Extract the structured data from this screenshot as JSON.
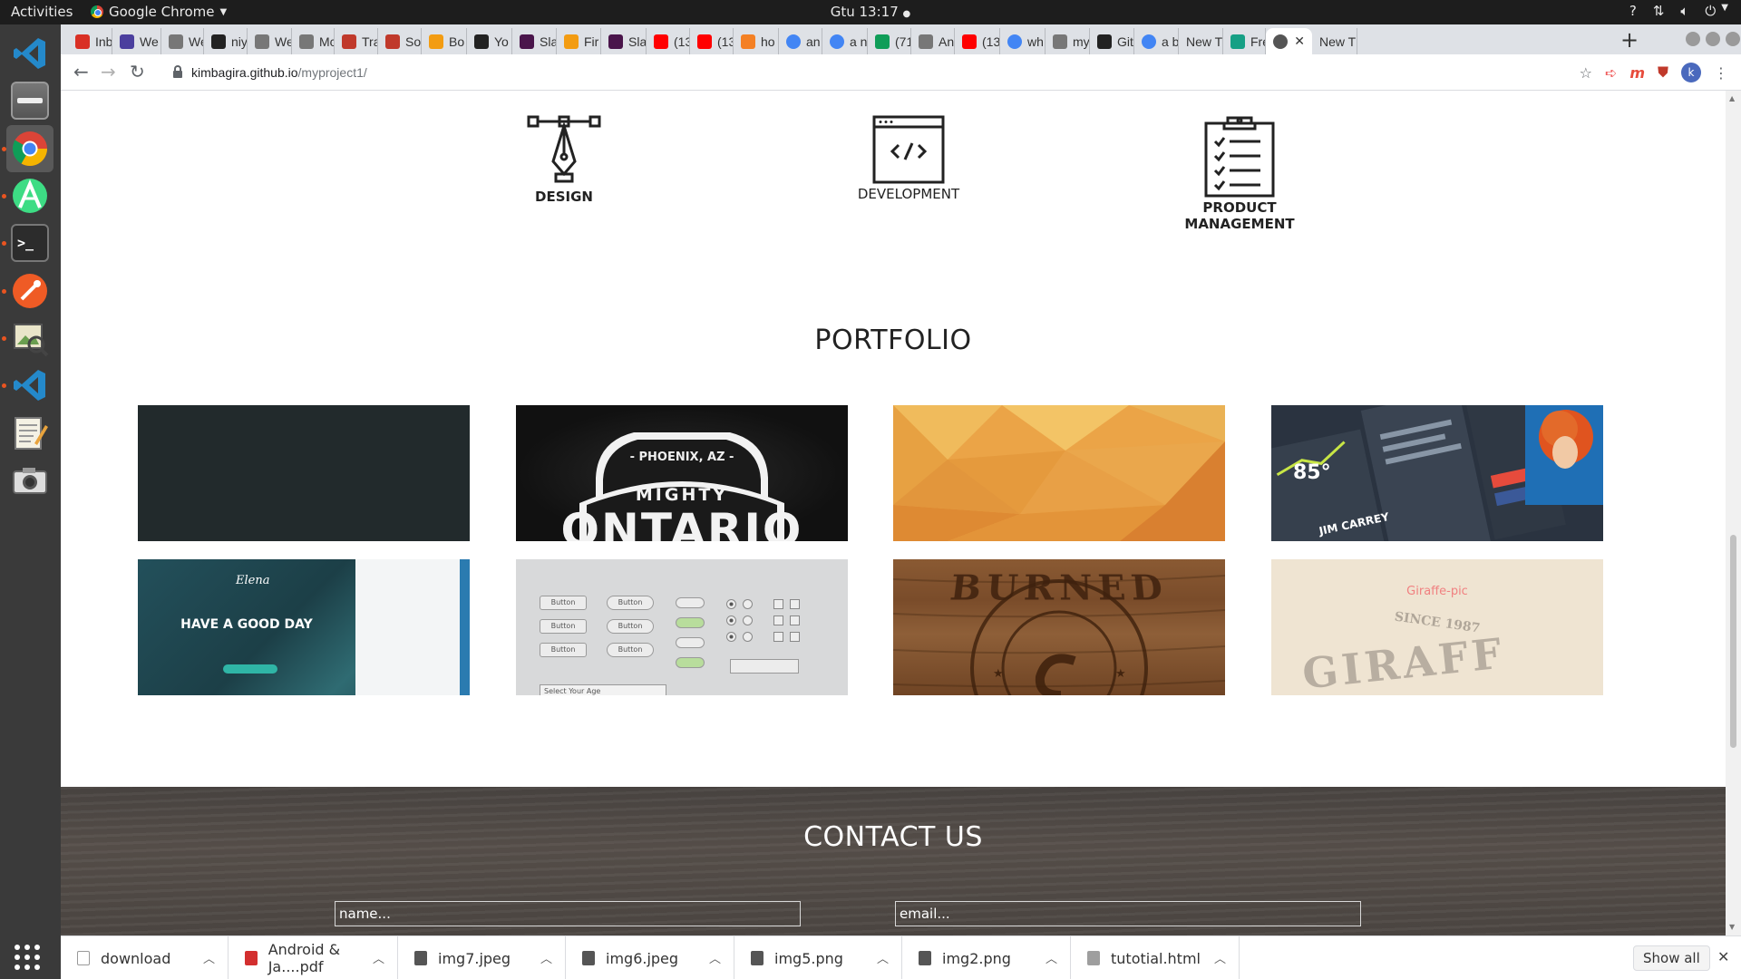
{
  "topbar": {
    "activities": "Activities",
    "app_name": "Google Chrome",
    "clock": "Gtu 13:17",
    "tray_icons": [
      "help-icon",
      "network-icon",
      "volume-icon",
      "power-icon"
    ]
  },
  "dock": {
    "items": [
      "vscode",
      "files",
      "chrome",
      "android-studio",
      "terminal",
      "postman",
      "image-viewer",
      "vscode",
      "text-editor",
      "screenshot"
    ]
  },
  "tabs": [
    {
      "label": "Inb",
      "icon": "gmail-icon",
      "color": "#d93025"
    },
    {
      "label": "We",
      "icon": "web-icon",
      "color": "#4b3f9e"
    },
    {
      "label": "We",
      "icon": "web-icon",
      "color": "#777"
    },
    {
      "label": "niy",
      "icon": "github-icon",
      "color": "#222"
    },
    {
      "label": "We",
      "icon": "web-icon",
      "color": "#777"
    },
    {
      "label": "Mc",
      "icon": "web-icon",
      "color": "#777"
    },
    {
      "label": "Tra",
      "icon": "trello-icon",
      "color": "#c0392b"
    },
    {
      "label": "Sol",
      "icon": "web-icon",
      "color": "#c0392b"
    },
    {
      "label": "Bo",
      "icon": "firebase-icon",
      "color": "#f39c12"
    },
    {
      "label": "Yo",
      "icon": "github-icon",
      "color": "#222"
    },
    {
      "label": "Sla",
      "icon": "slack-icon",
      "color": "#4a154b"
    },
    {
      "label": "Fir",
      "icon": "firebase-icon",
      "color": "#f39c12"
    },
    {
      "label": "Sla",
      "icon": "slack-icon",
      "color": "#4a154b"
    },
    {
      "label": "(13",
      "icon": "youtube-icon",
      "color": "#ff0000"
    },
    {
      "label": "(13",
      "icon": "youtube-icon",
      "color": "#ff0000"
    },
    {
      "label": "ho",
      "icon": "stackoverflow-icon",
      "color": "#f48024"
    },
    {
      "label": "an",
      "icon": "google-icon",
      "color": "#4285f4"
    },
    {
      "label": "a n",
      "icon": "google-icon",
      "color": "#4285f4"
    },
    {
      "label": "(71",
      "icon": "hangouts-icon",
      "color": "#0f9d58"
    },
    {
      "label": "An",
      "icon": "web-icon",
      "color": "#777"
    },
    {
      "label": "(13",
      "icon": "youtube-icon",
      "color": "#ff0000"
    },
    {
      "label": "wh",
      "icon": "google-icon",
      "color": "#4285f4"
    },
    {
      "label": "my",
      "icon": "web-icon",
      "color": "#777"
    },
    {
      "label": "Git",
      "icon": "github-icon",
      "color": "#222"
    },
    {
      "label": "a b",
      "icon": "google-icon",
      "color": "#4285f4"
    },
    {
      "label": "New T",
      "icon": "",
      "color": ""
    },
    {
      "label": "Fre",
      "icon": "web-icon",
      "color": "#16a085"
    },
    {
      "label": "",
      "icon": "globe-icon",
      "color": "#555",
      "active": true
    },
    {
      "label": "New T",
      "icon": "",
      "color": ""
    }
  ],
  "address": {
    "domain": "kimbagira.github.io",
    "path": "/myproject1/"
  },
  "services": [
    {
      "label": "DESIGN",
      "icon": "pen-tool-icon"
    },
    {
      "label": "DEVELOPMENT",
      "icon": "code-window-icon"
    },
    {
      "label": "PRODUCT MANAGEMENT",
      "icon": "clipboard-checklist-icon"
    }
  ],
  "portfolio": {
    "title": "PORTFOLIO",
    "tiles": [
      {
        "name": "dark-slate"
      },
      {
        "name": "mighty-ontario",
        "line1": "- PHOENIX, AZ -",
        "line2": "MIGHTY",
        "line3": "ONTARIO"
      },
      {
        "name": "orange-polygon"
      },
      {
        "name": "dashboard-ui",
        "temp": "85°",
        "caption": "JIM CARREY"
      },
      {
        "name": "elena-template",
        "brand": "Elena",
        "headline": "HAVE A GOOD DAY"
      },
      {
        "name": "ui-kit",
        "button": "Button",
        "select": "Select Your Age"
      },
      {
        "name": "burned-wood",
        "text": "BURNED"
      },
      {
        "name": "giraffe",
        "alt": "Giraffe-pic",
        "since": "SINCE 1987",
        "word": "GIRAFF"
      }
    ]
  },
  "contact": {
    "title": "CONTACT US",
    "name_placeholder": "name...",
    "email_placeholder": "email..."
  },
  "downloads": {
    "items": [
      {
        "name": "download",
        "type": "file"
      },
      {
        "name": "Android & Ja....pdf",
        "type": "pdf"
      },
      {
        "name": "img7.jpeg",
        "type": "image"
      },
      {
        "name": "img6.jpeg",
        "type": "image"
      },
      {
        "name": "img5.png",
        "type": "image"
      },
      {
        "name": "img2.png",
        "type": "image"
      },
      {
        "name": "tutotial.html",
        "type": "html"
      }
    ],
    "show_all": "Show all"
  }
}
